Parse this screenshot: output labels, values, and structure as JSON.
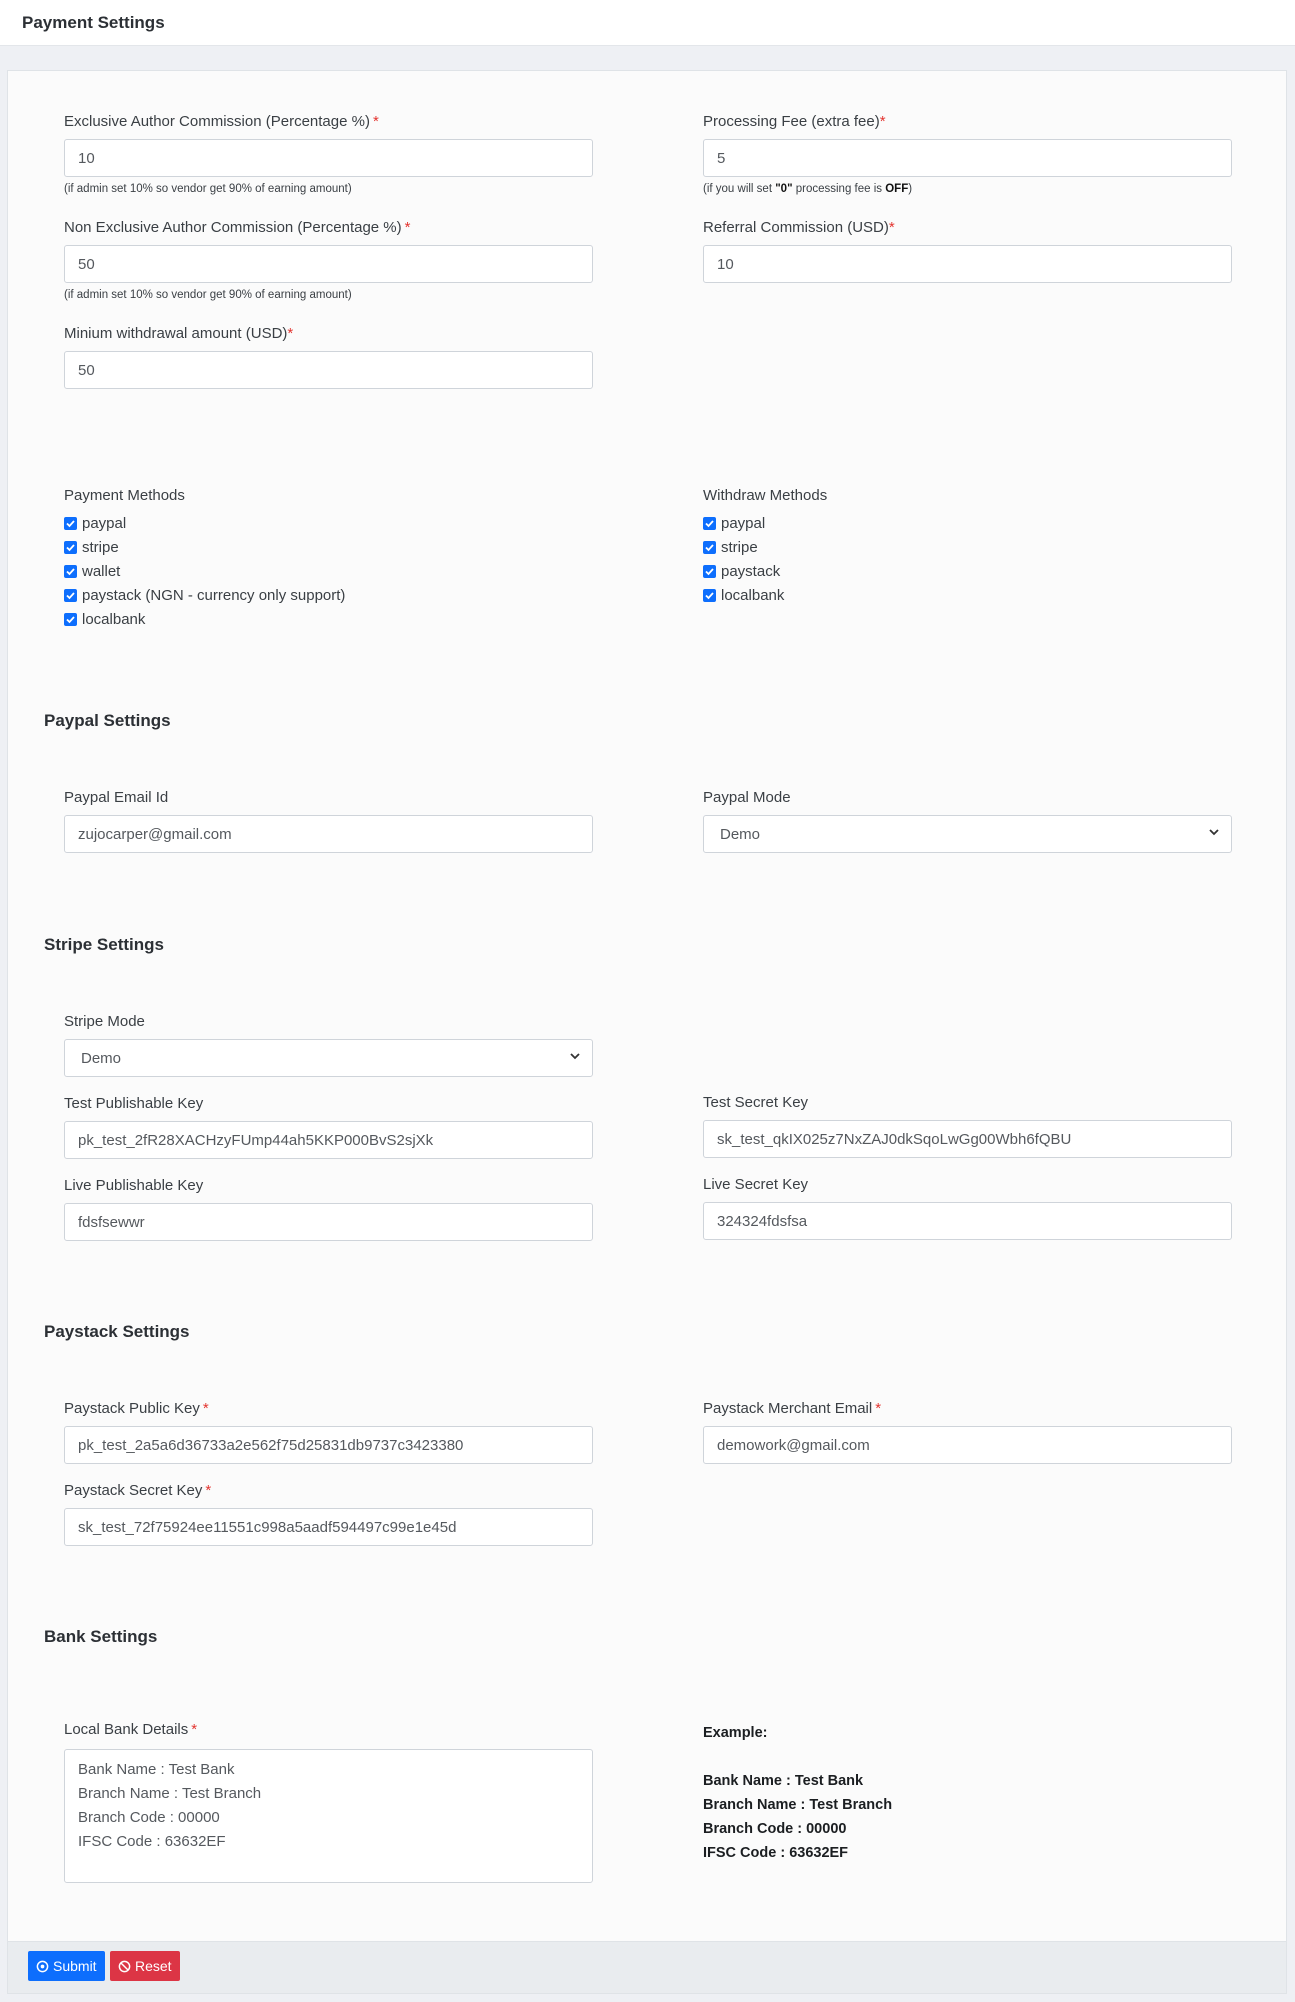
{
  "page": {
    "title": "Payment Settings"
  },
  "general": {
    "exclusive": {
      "label": "Exclusive Author Commission (Percentage %)",
      "value": "10",
      "help": "(if admin set 10% so vendor get 90% of earning amount)"
    },
    "processing": {
      "label": "Processing Fee (extra fee)",
      "value": "5",
      "help_pre": "(if you will set ",
      "help_zero": "\"0\"",
      "help_mid": " processing fee is ",
      "help_off": "OFF",
      "help_post": ")"
    },
    "non_exclusive": {
      "label": "Non Exclusive Author Commission (Percentage %)",
      "value": "50",
      "help": "(if admin set 10% so vendor get 90% of earning amount)"
    },
    "referral": {
      "label": "Referral Commission (USD)",
      "value": "10"
    },
    "min_withdrawal": {
      "label": "Minium withdrawal amount (USD)",
      "value": "50"
    },
    "required_mark": "*"
  },
  "payment_methods": {
    "title": "Payment Methods",
    "items": [
      "paypal",
      "stripe",
      "wallet",
      "paystack (NGN - currency only support)",
      "localbank"
    ]
  },
  "withdraw_methods": {
    "title": "Withdraw Methods",
    "items": [
      "paypal",
      "stripe",
      "paystack",
      "localbank"
    ]
  },
  "paypal": {
    "heading": "Paypal Settings",
    "email_label": "Paypal Email Id",
    "email_value": "zujocarper@gmail.com",
    "mode_label": "Paypal Mode",
    "mode_value": "Demo"
  },
  "stripe": {
    "heading": "Stripe Settings",
    "mode_label": "Stripe Mode",
    "mode_value": "Demo",
    "test_pub_label": "Test Publishable Key",
    "test_pub_value": "pk_test_2fR28XACHzyFUmp44ah5KKP000BvS2sjXk",
    "test_secret_label": "Test Secret Key",
    "test_secret_value": "sk_test_qkIX025z7NxZAJ0dkSqoLwGg00Wbh6fQBU",
    "live_pub_label": "Live Publishable Key",
    "live_pub_value": "fdsfsewwr",
    "live_secret_label": "Live Secret Key",
    "live_secret_value": "324324fdsfsa"
  },
  "paystack": {
    "heading": "Paystack Settings",
    "public_label": "Paystack Public Key",
    "public_value": "pk_test_2a5a6d36733a2e562f75d25831db9737c3423380",
    "merchant_label": "Paystack Merchant Email",
    "merchant_value": "demowork@gmail.com",
    "secret_label": "Paystack Secret Key",
    "secret_value": "sk_test_72f75924ee11551c998a5aadf594497c99e1e45d"
  },
  "bank": {
    "heading": "Bank Settings",
    "details_label": "Local Bank Details",
    "details_value": "Bank Name : Test Bank\nBranch Name : Test Branch\nBranch Code : 00000\nIFSC Code : 63632EF",
    "example_title": "Example:",
    "example_lines": [
      "Bank Name : Test Bank",
      "Branch Name : Test Branch",
      "Branch Code : 00000",
      "IFSC Code : 63632EF"
    ]
  },
  "actions": {
    "submit": "Submit",
    "reset": "Reset"
  },
  "colors": {
    "primary": "#0d6efd",
    "danger": "#dc3545",
    "required": "#e3342f"
  }
}
